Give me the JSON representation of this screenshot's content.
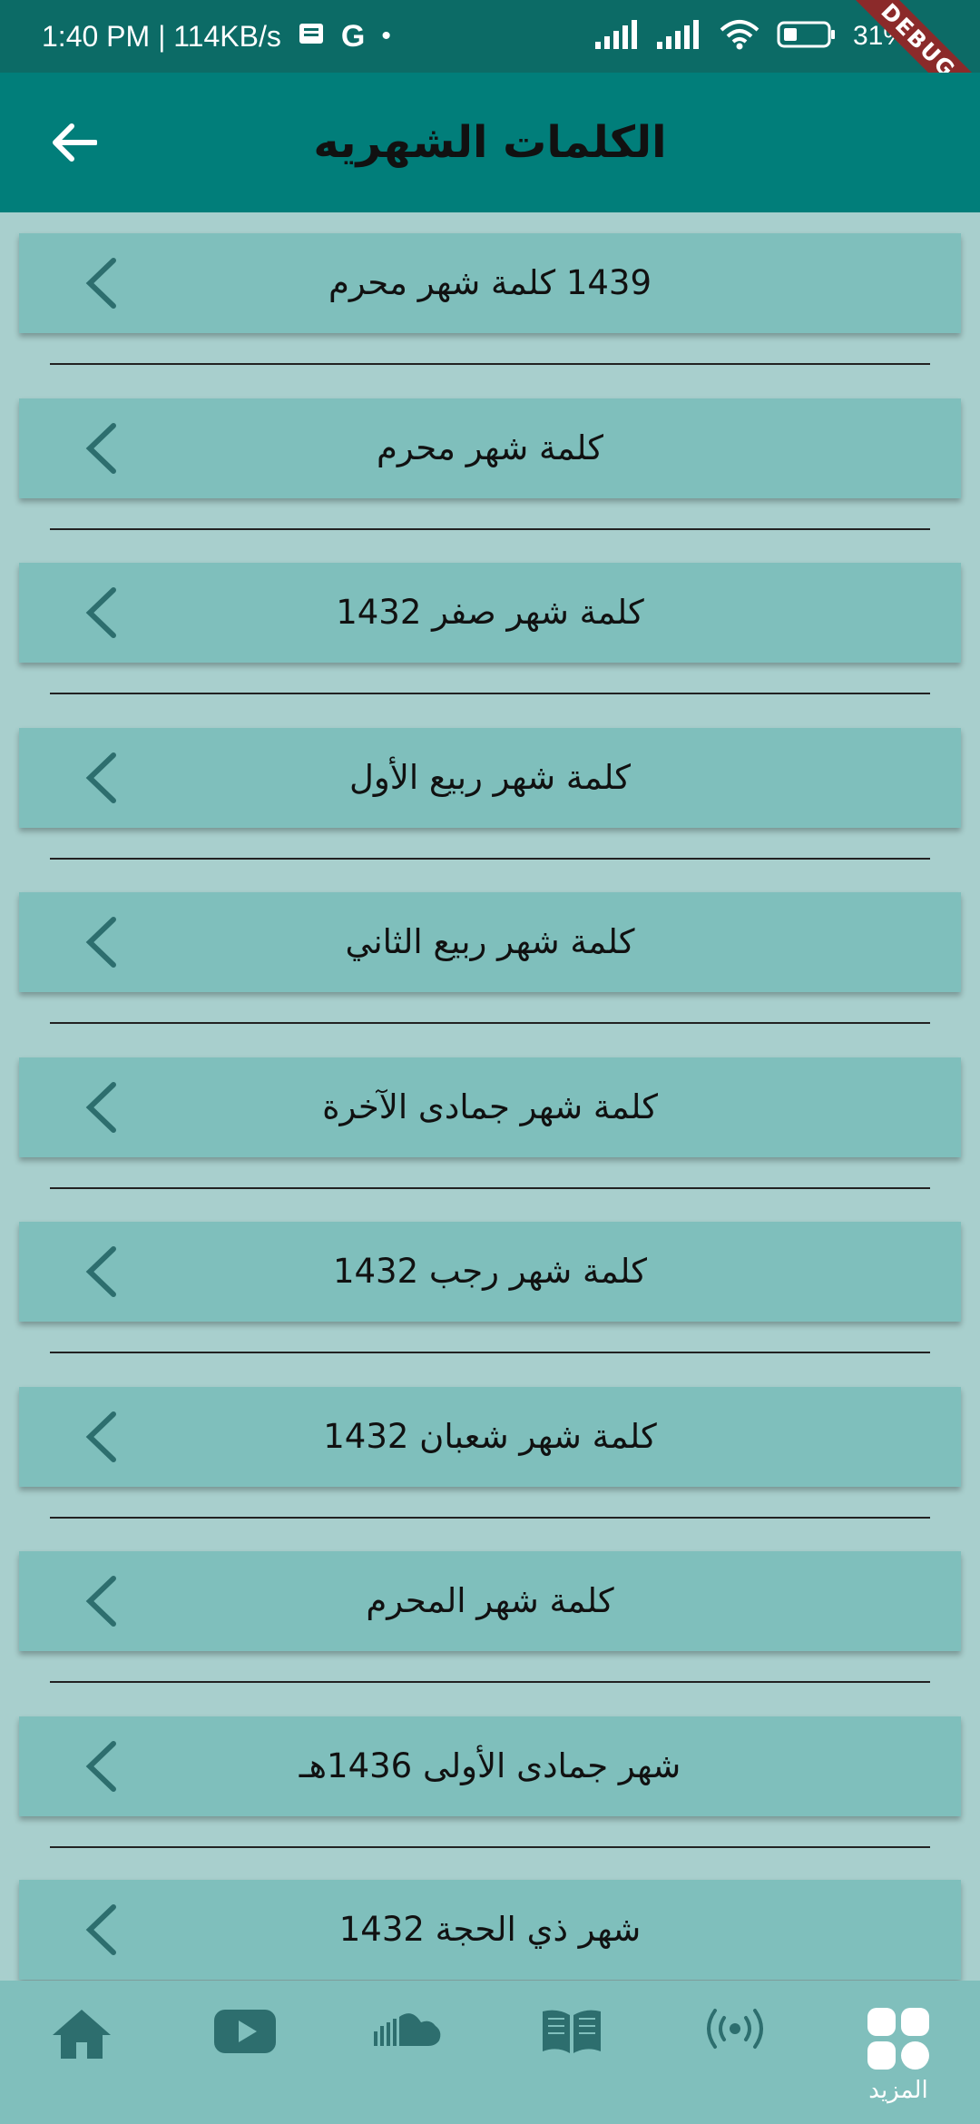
{
  "status_bar": {
    "time_speed": "1:40 PM | 114KB/s",
    "battery": "31%",
    "debug_banner": "DEBUG"
  },
  "app_bar": {
    "title": "الكلمات الشهريه",
    "back_icon": "arrow-back-icon"
  },
  "list": {
    "items": [
      {
        "label": "1439 كلمة شهر محرم"
      },
      {
        "label": "كلمة شهر محرم"
      },
      {
        "label": "كلمة شهر صفر 1432"
      },
      {
        "label": "كلمة شهر ربيع الأول"
      },
      {
        "label": "كلمة شهر ربيع الثاني"
      },
      {
        "label": "كلمة شهر جمادى الآخرة"
      },
      {
        "label": "كلمة شهر رجب 1432"
      },
      {
        "label": "كلمة شهر شعبان 1432"
      },
      {
        "label": "كلمة شهر المحرم"
      },
      {
        "label": "شهر جمادى الأولى 1436هـ"
      },
      {
        "label": "شهر ذي الحجة 1432"
      }
    ],
    "item_icon": "chevron-left-icon"
  },
  "bottom_nav": {
    "items": [
      {
        "icon": "home-icon",
        "label": ""
      },
      {
        "icon": "youtube-icon",
        "label": ""
      },
      {
        "icon": "soundcloud-icon",
        "label": ""
      },
      {
        "icon": "book-icon",
        "label": ""
      },
      {
        "icon": "broadcast-icon",
        "label": ""
      },
      {
        "icon": "grid-more-icon",
        "label": "المزيد"
      }
    ]
  },
  "colors": {
    "status_bar": "#0c6b66",
    "app_bar": "#017e7a",
    "background": "#a8cfcd",
    "list_item": "#7fbfbc",
    "nav_icon": "#2d6e6e",
    "nav_bg": "#80bfbc"
  }
}
